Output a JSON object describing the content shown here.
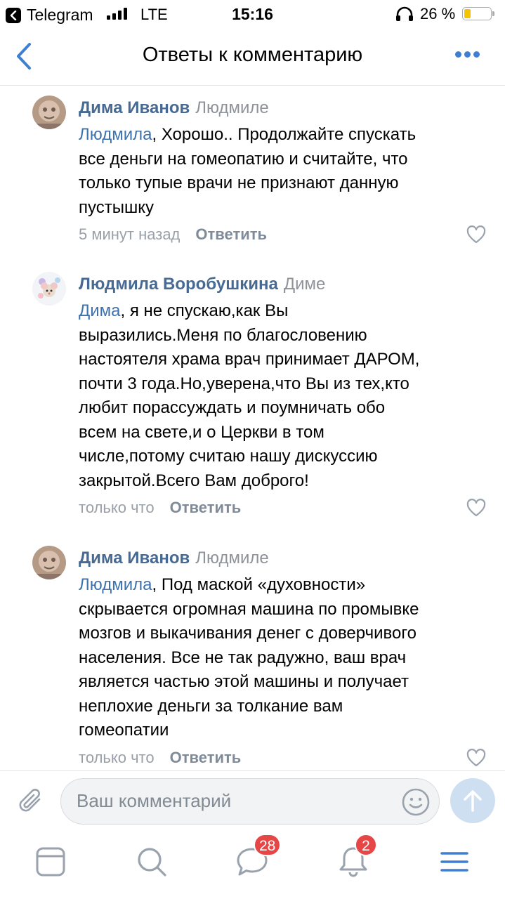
{
  "status_bar": {
    "back_app": "Telegram",
    "network": "LTE",
    "time": "15:16",
    "battery": "26 %",
    "battery_level": 0.26
  },
  "nav": {
    "title": "Ответы к комментарию",
    "back_icon": "chevron-left-icon",
    "more_icon": "more-dots-icon"
  },
  "comments": [
    {
      "author": "Дима Иванов",
      "reply_to": "Людмиле",
      "mention": "Людмила",
      "text_lines": [
        ", Хорошо.. Продолжайте спускать",
        "все деньги на гомеопатию и считайте, что",
        "только тупые врачи не признают данную",
        "пустышку"
      ],
      "time": "5 минут назад",
      "reply_label": "Ответить"
    },
    {
      "author": "Людмила Воробушкина",
      "reply_to": "Диме",
      "mention": "Дима",
      "text_lines": [
        ", я не спускаю,как Вы",
        "выразились.Меня по благословению",
        "настоятеля храма врач принимает ДАРОМ,",
        "почти 3 года.Но,уверена,что Вы из тех,кто",
        "любит порассуждать и поумничать обо",
        "всем на свете,и о Церкви в том",
        "числе,потому считаю нашу дискуссию",
        "закрытой.Всего Вам доброго!"
      ],
      "time": "только что",
      "reply_label": "Ответить"
    },
    {
      "author": "Дима Иванов",
      "reply_to": "Людмиле",
      "mention": "Людмила",
      "text_lines": [
        ", Под маской «духовности»",
        "скрывается огромная машина по промывке",
        "мозгов и выкачивания денег с доверчивого",
        "населения. Все не так радужно, ваш врач",
        "является частью этой машины и получает",
        "неплохие деньги за толкание вам",
        "гомеопатии"
      ],
      "time": "только что",
      "reply_label": "Ответить"
    }
  ],
  "composer": {
    "placeholder": "Ваш комментарий"
  },
  "tabs": [
    {
      "icon": "news-feed-icon"
    },
    {
      "icon": "search-icon"
    },
    {
      "icon": "messages-icon",
      "badge": "28"
    },
    {
      "icon": "notifications-icon",
      "badge": "2"
    },
    {
      "icon": "menu-icon"
    }
  ],
  "colors": {
    "accent": "#3f7fd1",
    "author": "#476a94",
    "meta": "#9aa0a8",
    "badge": "#e64646"
  }
}
